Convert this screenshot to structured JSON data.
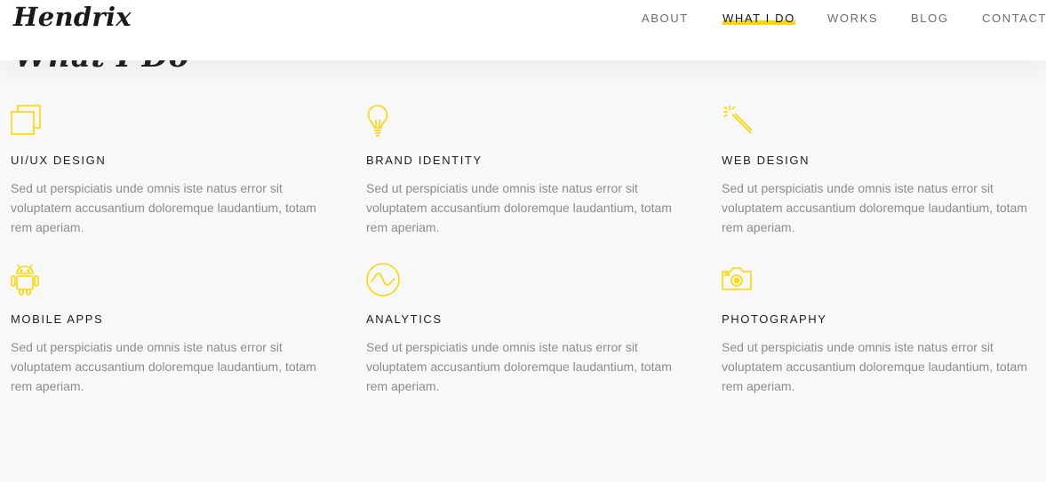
{
  "brand": {
    "logo": "Hendrix",
    "accent": "#ffd600"
  },
  "nav": {
    "items": [
      "ABOUT",
      "WHAT I DO",
      "WORKS",
      "BLOG",
      "CONTACT"
    ],
    "active": "WHAT I DO"
  },
  "section": {
    "title": "What I Do"
  },
  "services": [
    {
      "title": "UI/UX DESIGN",
      "icon": "copy-squares-icon",
      "text": "Sed ut perspiciatis unde omnis iste natus error sit voluptatem accusantium doloremque laudantium, totam rem aperiam."
    },
    {
      "title": "BRAND IDENTITY",
      "icon": "lightbulb-icon",
      "text": "Sed ut perspiciatis unde omnis iste natus error sit voluptatem accusantium doloremque laudantium, totam rem aperiam."
    },
    {
      "title": "WEB DESIGN",
      "icon": "magic-wand-icon",
      "text": "Sed ut perspiciatis unde omnis iste natus error sit voluptatem accusantium doloremque laudantium, totam rem aperiam."
    },
    {
      "title": "MOBILE APPS",
      "icon": "android-icon",
      "text": "Sed ut perspiciatis unde omnis iste natus error sit voluptatem accusantium doloremque laudantium, totam rem aperiam."
    },
    {
      "title": "ANALYTICS",
      "icon": "wave-circle-icon",
      "text": "Sed ut perspiciatis unde omnis iste natus error sit voluptatem accusantium doloremque laudantium, totam rem aperiam."
    },
    {
      "title": "PHOTOGRAPHY",
      "icon": "camera-icon",
      "text": "Sed ut perspiciatis unde omnis iste natus error sit voluptatem accusantium doloremque laudantium, totam rem aperiam."
    }
  ]
}
